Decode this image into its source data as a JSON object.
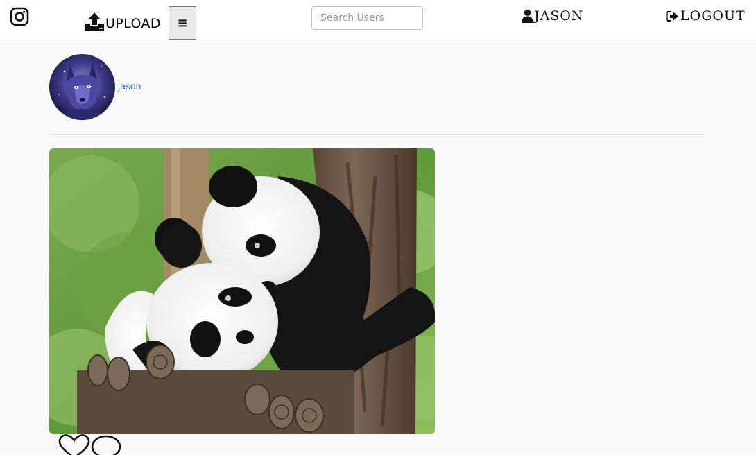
{
  "nav": {
    "logo_icon": "instagram-icon",
    "upload_icon": "upload-icon",
    "upload_label": "UPLOAD",
    "menu_icon": "hamburger-icon",
    "menu_label": "≡",
    "search_placeholder": "Search Users",
    "search_value": "",
    "user_icon": "user-icon",
    "user_label": "JASON",
    "logout_icon": "sign-out-icon",
    "logout_label": "LOGOUT"
  },
  "profile": {
    "avatar_icon": "wolf-avatar",
    "username": "jason"
  },
  "post": {
    "image": "two-pandas-on-wooden-platform",
    "like_icon": "heart-outline-icon",
    "comment_icon": "comment-outline-icon"
  },
  "colors": {
    "background": "#fafafa",
    "nav_background": "#ffffff",
    "link": "#3b6fc4",
    "border": "#dbdbdb"
  }
}
